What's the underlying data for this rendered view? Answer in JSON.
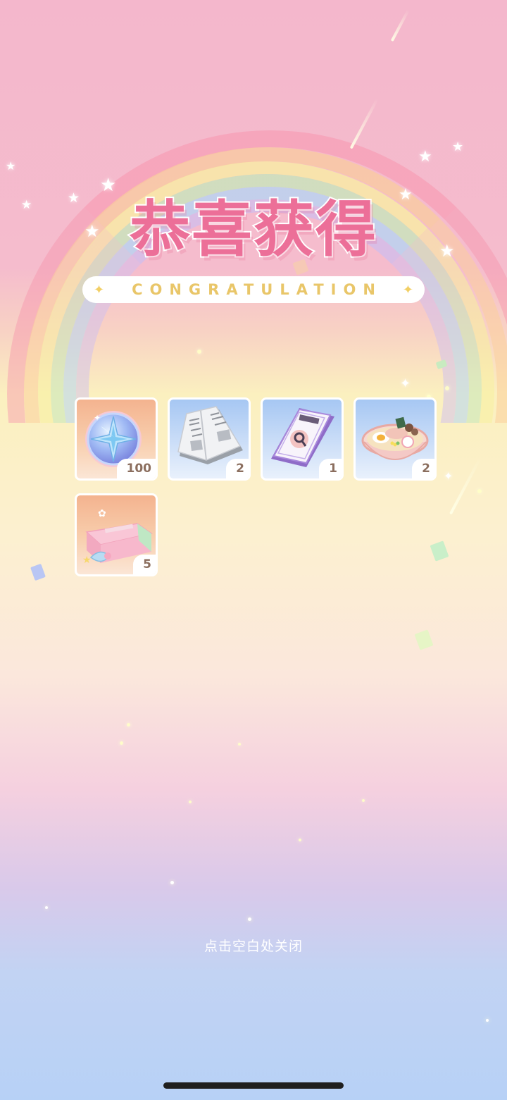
{
  "dialog": {
    "title": "恭喜获得",
    "subtitle": "CONGRATULATION",
    "close_hint": "点击空白处关闭"
  },
  "rewards": [
    {
      "name": "compass-crystal-coin",
      "count": "100",
      "bg": "orange"
    },
    {
      "name": "newspaper",
      "count": "2",
      "bg": "blue"
    },
    {
      "name": "purple-magazine",
      "count": "1",
      "bg": "blue"
    },
    {
      "name": "ramen-bowl",
      "count": "2",
      "bg": "blue"
    },
    {
      "name": "pink-gift-box",
      "count": "5",
      "bg": "orange"
    }
  ],
  "colors": {
    "title": "#ec6f98",
    "subtitle": "#e9c669",
    "count_text": "#8b6e5e"
  }
}
